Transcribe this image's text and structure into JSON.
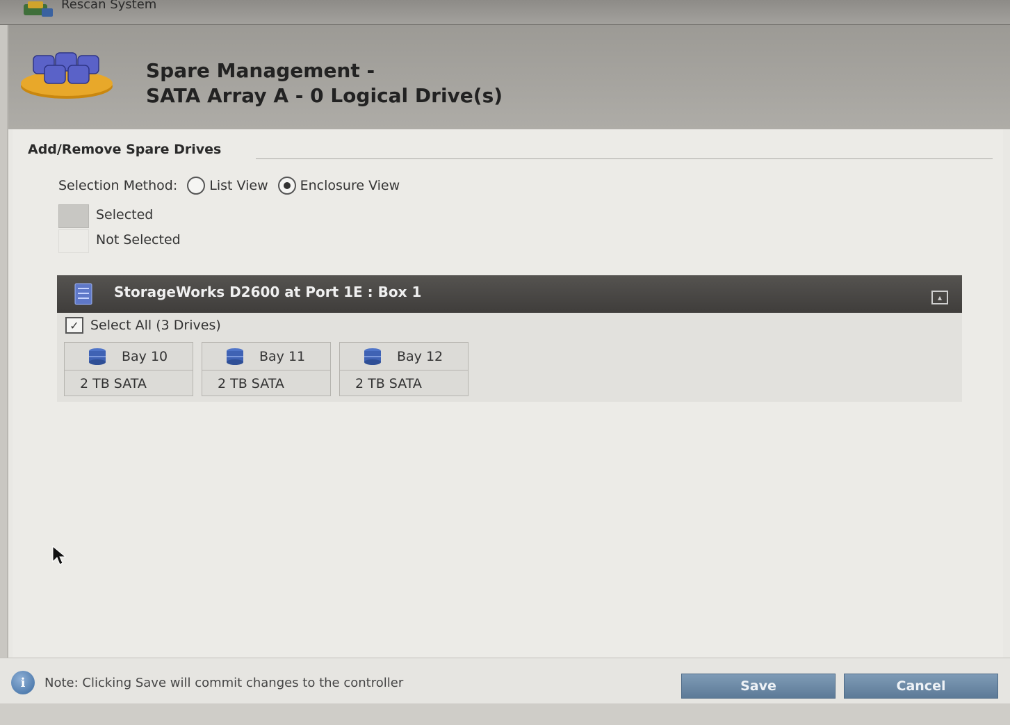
{
  "topbar": {
    "label": "Rescan System",
    "icon": "rescan-icon"
  },
  "header": {
    "title_line1": "Spare Management -",
    "title_line2": "SATA Array A - 0 Logical Drive(s)",
    "icon": "disk-array-icon"
  },
  "section": {
    "title": "Add/Remove Spare Drives",
    "selection_method_label": "Selection Method:",
    "options": [
      {
        "label": "List View",
        "selected": false
      },
      {
        "label": "Enclosure View",
        "selected": true
      }
    ],
    "legend": [
      {
        "label": "Selected",
        "color": "#c8c7c3"
      },
      {
        "label": "Not Selected",
        "color": "#ecebe7"
      }
    ]
  },
  "enclosure": {
    "title": "StorageWorks D2600 at Port 1E : Box 1",
    "select_all_label": "Select All (3 Drives)",
    "select_all_checked": true,
    "bays": [
      {
        "name": "Bay 10",
        "capacity": "2 TB SATA"
      },
      {
        "name": "Bay 11",
        "capacity": "2 TB SATA"
      },
      {
        "name": "Bay 12",
        "capacity": "2 TB SATA"
      }
    ]
  },
  "footer": {
    "note": "Note: Clicking Save will commit changes to the controller",
    "save_label": "Save",
    "cancel_label": "Cancel"
  },
  "colors": {
    "button": "#6b89a6",
    "enclosure_bar": "#4a4846",
    "header": "#a6a49f"
  }
}
